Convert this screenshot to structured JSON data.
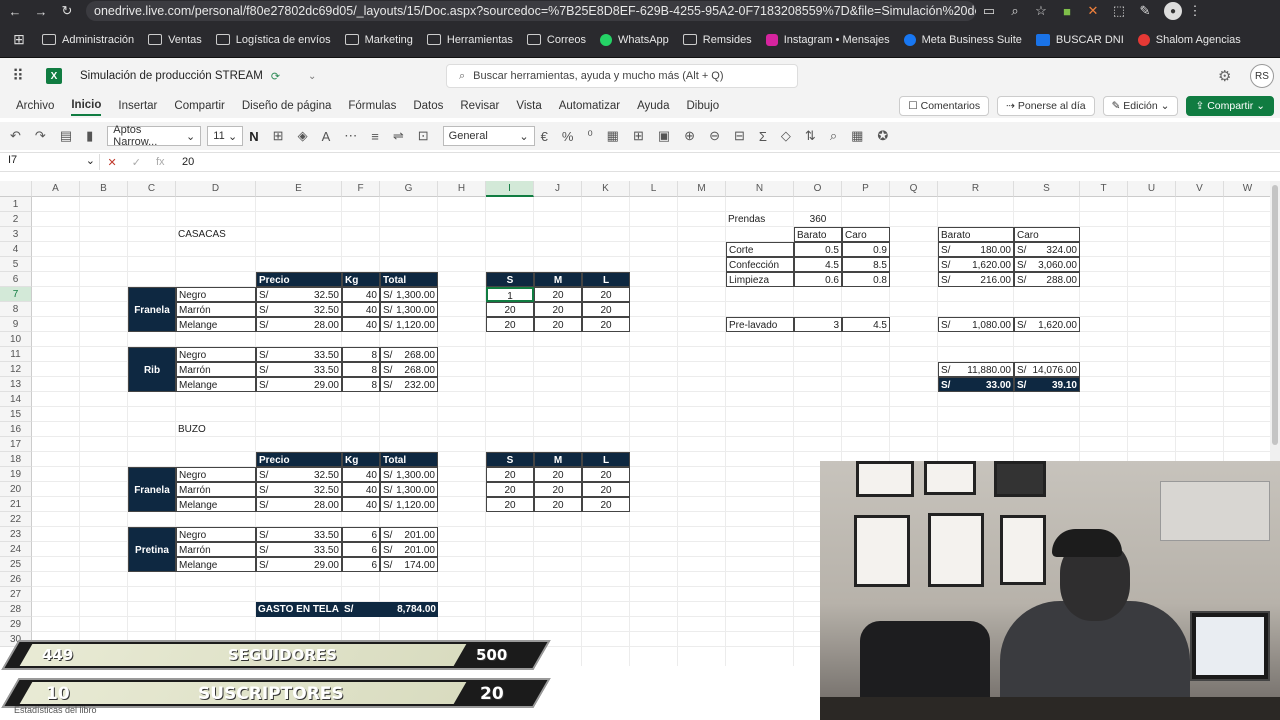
{
  "browser": {
    "url": "onedrive.live.com/personal/f80e27802dc69d05/_layouts/15/Doc.aspx?sourcedoc=%7B25E8D8EF-629B-4255-95A2-0F7183208559%7D&file=Simulación%20de%20p...",
    "bookmarks": [
      "Administración",
      "Ventas",
      "Logística de envíos",
      "Marketing",
      "Herramientas",
      "Correos",
      "WhatsApp",
      "Remsides",
      "Instagram • Mensajes",
      "Meta Business Suite",
      "BUSCAR DNI",
      "Shalom Agencias"
    ]
  },
  "app": {
    "doc_name": "Simulación de producción STREAM",
    "search_placeholder": "Buscar herramientas, ayuda y mucho más (Alt + Q)",
    "user_initials": "RS",
    "menu": [
      "Archivo",
      "Inicio",
      "Insertar",
      "Compartir",
      "Diseño de página",
      "Fórmulas",
      "Datos",
      "Revisar",
      "Vista",
      "Automatizar",
      "Ayuda",
      "Dibujo"
    ],
    "active_menu": "Inicio",
    "buttons": {
      "comments": "Comentarios",
      "catch_up": "Ponerse al día",
      "editing": "Edición",
      "share": "Compartir"
    },
    "font_name": "Aptos Narrow...",
    "font_size": "11",
    "number_format": "General",
    "name_box": "I7",
    "formula_value": "20",
    "accent": "#107c41",
    "header_fill": "#0e2841"
  },
  "grid": {
    "columns": [
      "A",
      "B",
      "C",
      "D",
      "E",
      "F",
      "G",
      "H",
      "I",
      "J",
      "K",
      "L",
      "M",
      "N",
      "O",
      "P",
      "Q",
      "R",
      "S",
      "T",
      "U",
      "V",
      "W"
    ],
    "rows": [
      "1",
      "2",
      "3",
      "4",
      "5",
      "6",
      "7",
      "8",
      "9",
      "10",
      "11",
      "12",
      "13",
      "14",
      "15",
      "16",
      "17",
      "18",
      "19",
      "20",
      "21",
      "22",
      "23",
      "24",
      "25",
      "26",
      "27",
      "28",
      "29",
      "30"
    ],
    "selected_col": "I",
    "selected_row": "7"
  },
  "sheet": {
    "casacas_title": "CASACAS",
    "buzo_title": "BUZO",
    "headers": {
      "precio": "Precio",
      "kg": "Kg",
      "total": "Total",
      "s": "S",
      "m": "M",
      "l": "L"
    },
    "currency": "S/",
    "casacas_franela": {
      "label": "Franela",
      "rows": [
        {
          "color": "Negro",
          "precio": "32.50",
          "kg": "40",
          "total": "1,300.00"
        },
        {
          "color": "Marrón",
          "precio": "32.50",
          "kg": "40",
          "total": "1,300.00"
        },
        {
          "color": "Melange",
          "precio": "28.00",
          "kg": "40",
          "total": "1,120.00"
        }
      ]
    },
    "casacas_rib": {
      "label": "Rib",
      "rows": [
        {
          "color": "Negro",
          "precio": "33.50",
          "kg": "8",
          "total": "268.00"
        },
        {
          "color": "Marrón",
          "precio": "33.50",
          "kg": "8",
          "total": "268.00"
        },
        {
          "color": "Melange",
          "precio": "29.00",
          "kg": "8",
          "total": "232.00"
        }
      ]
    },
    "casacas_sizes": [
      [
        "1",
        "20",
        "20"
      ],
      [
        "20",
        "20",
        "20"
      ],
      [
        "20",
        "20",
        "20"
      ]
    ],
    "buzo_franela": {
      "label": "Franela",
      "rows": [
        {
          "color": "Negro",
          "precio": "32.50",
          "kg": "40",
          "total": "1,300.00"
        },
        {
          "color": "Marrón",
          "precio": "32.50",
          "kg": "40",
          "total": "1,300.00"
        },
        {
          "color": "Melange",
          "precio": "28.00",
          "kg": "40",
          "total": "1,120.00"
        }
      ]
    },
    "buzo_pretina": {
      "label": "Pretina",
      "rows": [
        {
          "color": "Negro",
          "precio": "33.50",
          "kg": "6",
          "total": "201.00"
        },
        {
          "color": "Marrón",
          "precio": "33.50",
          "kg": "6",
          "total": "201.00"
        },
        {
          "color": "Melange",
          "precio": "29.00",
          "kg": "6",
          "total": "174.00"
        }
      ]
    },
    "buzo_sizes": [
      [
        "20",
        "20",
        "20"
      ],
      [
        "20",
        "20",
        "20"
      ],
      [
        "20",
        "20",
        "20"
      ]
    ],
    "gasto": {
      "label": "GASTO EN TELA",
      "currency": "S/",
      "value": "8,784.00"
    },
    "prendas": {
      "label": "Prendas",
      "value": "360"
    },
    "cost_headers": {
      "barato": "Barato",
      "caro": "Caro"
    },
    "costs": [
      {
        "label": "Corte",
        "barato": "0.5",
        "caro": "0.9",
        "t_barato": "180.00",
        "t_caro": "324.00"
      },
      {
        "label": "Confección",
        "barato": "4.5",
        "caro": "8.5",
        "t_barato": "1,620.00",
        "t_caro": "3,060.00"
      },
      {
        "label": "Limpieza",
        "barato": "0.6",
        "caro": "0.8",
        "t_barato": "216.00",
        "t_caro": "288.00"
      }
    ],
    "prelavado": {
      "label": "Pre-lavado",
      "barato": "3",
      "caro": "4.5",
      "t_barato": "1,080.00",
      "t_caro": "1,620.00"
    },
    "totals": {
      "barato": "11,880.00",
      "caro": "14,076.00"
    },
    "unit": {
      "barato": "33.00",
      "caro": "39.10"
    }
  },
  "overlay": {
    "seguidores_count": "449",
    "seguidores_label": "SEGUIDORES",
    "seguidores_goal": "500",
    "suscriptores_count": "10",
    "suscriptores_label": "SUSCRIPTORES",
    "suscriptores_goal": "20",
    "status_text": "Estadísticas del libro"
  }
}
